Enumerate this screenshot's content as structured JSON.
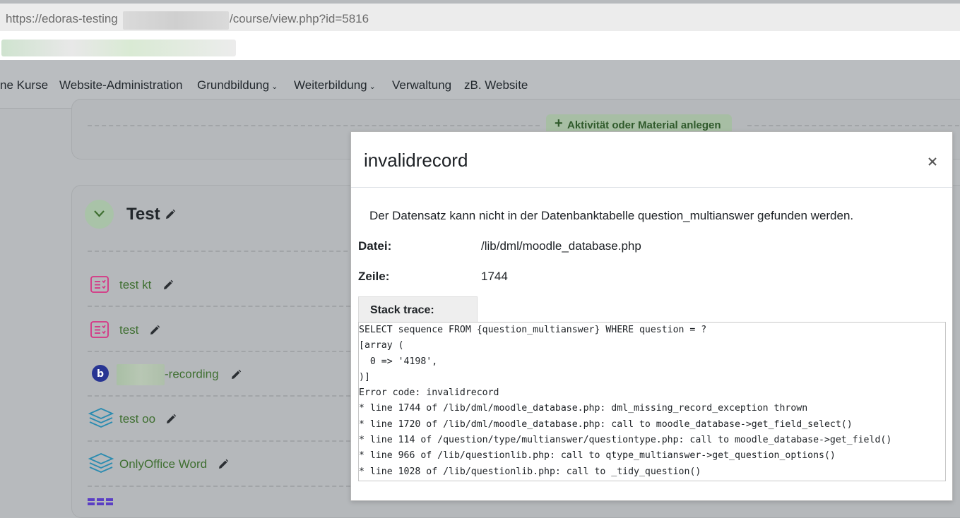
{
  "browser": {
    "url_start": "https://edoras-testing",
    "url_end": "/course/view.php?id=5816"
  },
  "navbar": {
    "items": [
      {
        "label": "ne Kurse"
      },
      {
        "label": "Website-Administration"
      },
      {
        "label": "Grundbildung",
        "chevron": "chevron-down-icon"
      },
      {
        "label": "Weiterbildung",
        "chevron": "chevron-down-icon"
      },
      {
        "label": "Verwaltung"
      },
      {
        "label": "zB. Website"
      }
    ]
  },
  "course": {
    "add_activity_label": "Aktivität oder Material anlegen",
    "add_activity_icon": "plus",
    "section_title": "Test",
    "activities": [
      {
        "label": "test kt",
        "icon": "quiz-icon"
      },
      {
        "label": "test",
        "icon": "quiz-icon"
      },
      {
        "label": "-recording",
        "icon": "bigbluebutton-icon"
      },
      {
        "label": "test oo",
        "icon": "onlyoffice-icon"
      },
      {
        "label": "OnlyOffice Word",
        "icon": "onlyoffice-icon"
      }
    ],
    "accent_color": "#3f6f31",
    "quiz_icon_color": "#d63384"
  },
  "modal": {
    "title": "invalidrecord",
    "close_symbol": "×",
    "message": "Der Datensatz kann nicht in der Datenbanktabelle question_multianswer gefunden werden.",
    "file_label": "Datei:",
    "file_value": "/lib/dml/moodle_database.php",
    "line_label": "Zeile:",
    "line_value": "1744",
    "stack_trace_label": "Stack trace:",
    "stack_trace": [
      "SELECT sequence FROM {question_multianswer} WHERE question = ?",
      "[array (",
      "  0 => '4198',",
      ")]",
      "Error code: invalidrecord",
      "* line 1744 of /lib/dml/moodle_database.php: dml_missing_record_exception thrown",
      "* line 1720 of /lib/dml/moodle_database.php: call to moodle_database->get_field_select()",
      "* line 114 of /question/type/multianswer/questiontype.php: call to moodle_database->get_field()",
      "* line 966 of /lib/questionlib.php: call to qtype_multianswer->get_question_options()",
      "* line 1028 of /lib/questionlib.php: call to _tidy_question()"
    ]
  }
}
